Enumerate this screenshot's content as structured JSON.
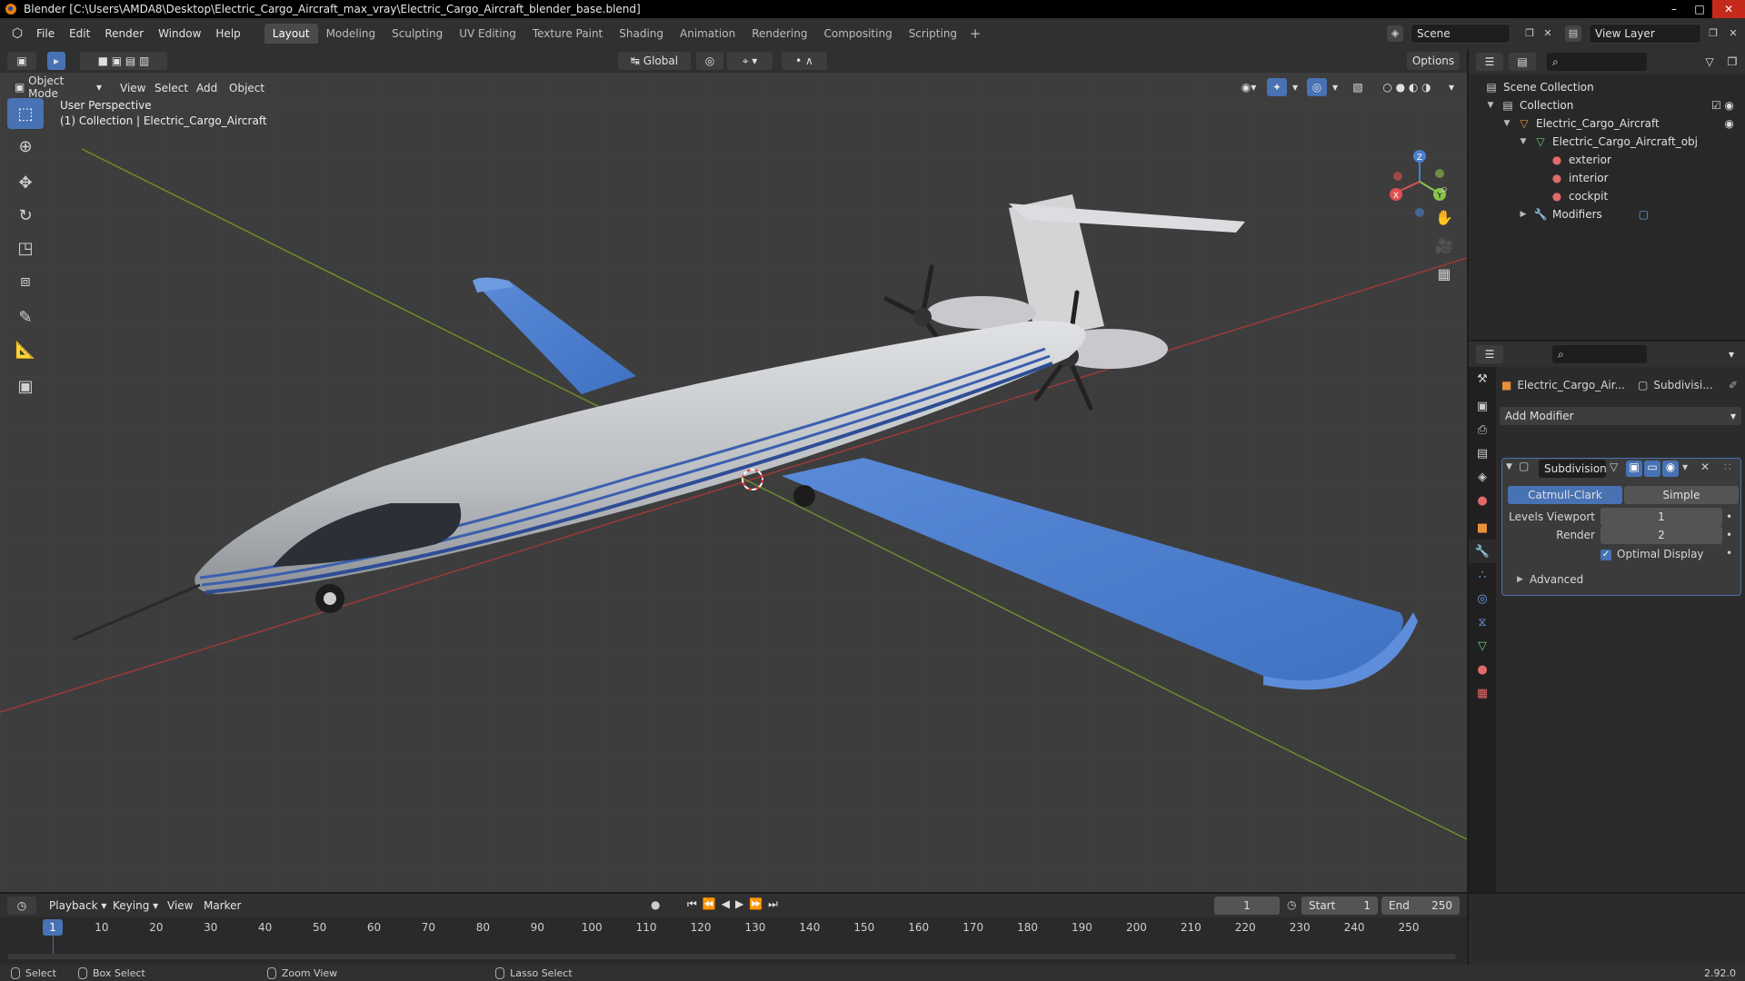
{
  "window": {
    "title": "Blender [C:\\Users\\AMDA8\\Desktop\\Electric_Cargo_Aircraft_max_vray\\Electric_Cargo_Aircraft_blender_base.blend]"
  },
  "menu": {
    "items": [
      "File",
      "Edit",
      "Render",
      "Window",
      "Help"
    ]
  },
  "workspaces": {
    "tabs": [
      "Layout",
      "Modeling",
      "Sculpting",
      "UV Editing",
      "Texture Paint",
      "Shading",
      "Animation",
      "Rendering",
      "Compositing",
      "Scripting"
    ],
    "active": "Layout",
    "add": "+"
  },
  "scene": {
    "name": "Scene",
    "view_layer": "View Layer"
  },
  "viewport": {
    "mode": "Object Mode",
    "menus": [
      "View",
      "Select",
      "Add",
      "Object"
    ],
    "orientation": "Global",
    "options": "Options",
    "perspective": "User Perspective",
    "collection_info": "(1) Collection | Electric_Cargo_Aircraft",
    "gizmo": {
      "x": "X",
      "y": "Y",
      "z": "Z"
    }
  },
  "outliner": {
    "rows": [
      {
        "label": "Scene Collection",
        "depth": 0
      },
      {
        "label": "Collection",
        "depth": 1
      },
      {
        "label": "Electric_Cargo_Aircraft",
        "depth": 2
      },
      {
        "label": "Electric_Cargo_Aircraft_obj",
        "depth": 3
      },
      {
        "label": "exterior",
        "depth": 4
      },
      {
        "label": "interior",
        "depth": 4
      },
      {
        "label": "cockpit",
        "depth": 4
      },
      {
        "label": "Modifiers",
        "depth": 3
      }
    ]
  },
  "properties": {
    "object_name": "Electric_Cargo_Air...",
    "modifier_short": "Subdivisi...",
    "add_modifier": "Add Modifier",
    "modifier": {
      "name": "Subdivision",
      "type_a": "Catmull-Clark",
      "type_b": "Simple",
      "levels_label": "Levels Viewport",
      "levels_value": "1",
      "render_label": "Render",
      "render_value": "2",
      "optimal_label": "Optimal Display",
      "advanced_label": "Advanced"
    }
  },
  "timeline": {
    "menus": [
      "Playback",
      "Keying",
      "View",
      "Marker"
    ],
    "current_frame": "1",
    "start_label": "Start",
    "start_value": "1",
    "end_label": "End",
    "end_value": "250",
    "ticks": [
      "1",
      "10",
      "20",
      "30",
      "40",
      "50",
      "60",
      "70",
      "80",
      "90",
      "100",
      "110",
      "120",
      "130",
      "140",
      "150",
      "160",
      "170",
      "180",
      "190",
      "200",
      "210",
      "220",
      "230",
      "240",
      "250"
    ]
  },
  "statusbar": {
    "select": "Select",
    "box_select": "Box Select",
    "zoom_view": "Zoom View",
    "lasso_select": "Lasso Select",
    "version": "2.92.0"
  },
  "colors": {
    "accent": "#4772b3",
    "wing_blue": "#4a7fd0",
    "fuselage": "#c8cbce",
    "axis_red": "#9b3a3a",
    "axis_green": "#6b8f2a"
  }
}
